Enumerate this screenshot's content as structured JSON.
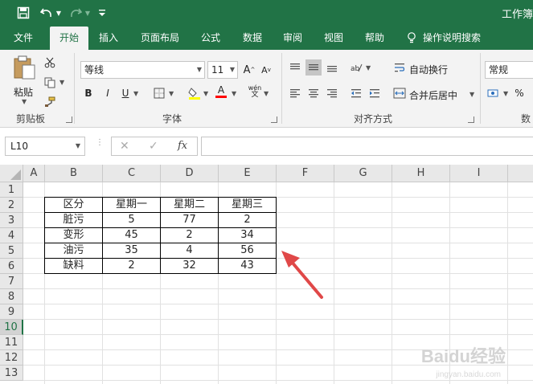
{
  "titlebar": {
    "doc_title": "工作簿",
    "save_icon": "save-icon",
    "undo_icon": "undo-icon",
    "redo_icon": "redo-icon",
    "customize_icon": "customize-quick-access-icon"
  },
  "tabs": [
    {
      "label": "文件",
      "active": false
    },
    {
      "label": "开始",
      "active": true
    },
    {
      "label": "插入",
      "active": false
    },
    {
      "label": "页面布局",
      "active": false
    },
    {
      "label": "公式",
      "active": false
    },
    {
      "label": "数据",
      "active": false
    },
    {
      "label": "审阅",
      "active": false
    },
    {
      "label": "视图",
      "active": false
    },
    {
      "label": "帮助",
      "active": false
    },
    {
      "label": "操作说明搜索",
      "active": false
    }
  ],
  "ribbon": {
    "clipboard": {
      "paste_label": "粘贴",
      "group_label": "剪贴板"
    },
    "font": {
      "font_name": "等线",
      "font_size": "11",
      "bold": "B",
      "italic": "I",
      "underline": "U",
      "font_color_glyph": "A",
      "phonetic_glyph": "wén",
      "group_label": "字体"
    },
    "alignment": {
      "wrap_text": "自动换行",
      "merge_center": "合并后居中",
      "group_label": "对齐方式"
    },
    "number": {
      "format": "常规",
      "percent": "%",
      "group_label": "数"
    }
  },
  "formula_bar": {
    "name_box": "L10",
    "fx": "fx",
    "formula": ""
  },
  "grid": {
    "columns": [
      "A",
      "B",
      "C",
      "D",
      "E",
      "F",
      "G",
      "H",
      "I"
    ],
    "rows": [
      "1",
      "2",
      "3",
      "4",
      "5",
      "6",
      "7",
      "8",
      "9",
      "10",
      "11",
      "12",
      "13"
    ],
    "active_row": "10",
    "table": {
      "headers": [
        "区分",
        "星期一",
        "星期二",
        "星期三"
      ],
      "rows": [
        [
          "脏污",
          "5",
          "77",
          "2"
        ],
        [
          "变形",
          "45",
          "2",
          "34"
        ],
        [
          "油污",
          "35",
          "4",
          "56"
        ],
        [
          "缺料",
          "2",
          "32",
          "43"
        ]
      ]
    }
  },
  "annotation": {
    "arrow_color": "#e04848"
  },
  "watermark": {
    "text": "Baidu经验",
    "sub": "jingyan.baidu.com"
  },
  "colors": {
    "accent": "#217346",
    "ribbon_bg": "#f3f3f3",
    "highlight_yellow": "#ffff00",
    "font_red": "#ff0000"
  }
}
